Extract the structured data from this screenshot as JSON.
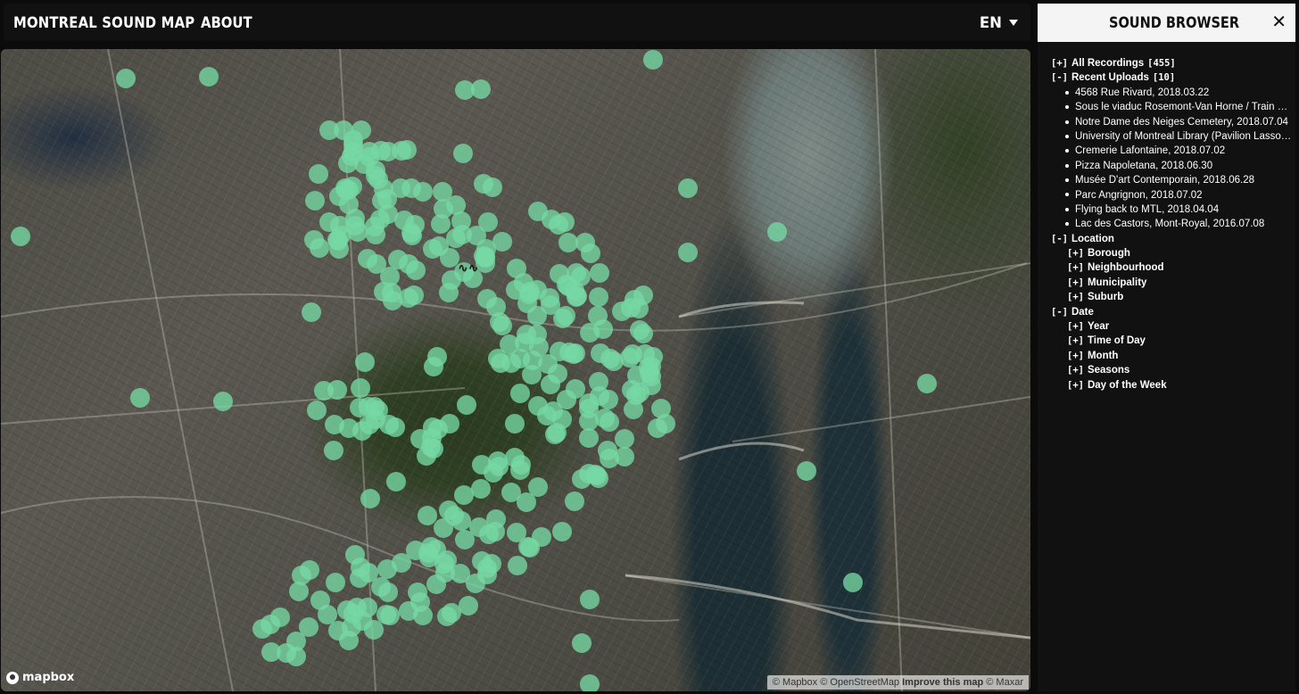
{
  "topbar": {
    "title": "MONTREAL SOUND MAP",
    "about": "ABOUT",
    "language": "EN"
  },
  "map": {
    "marker_color": "#76d8a4",
    "marker_count_visible": 330,
    "wave_glyph": "∿∿",
    "logo": "mapbox",
    "attribution": {
      "mapbox": "© Mapbox",
      "osm": "© OpenStreetMap",
      "improve": "Improve this map",
      "maxar": "© Maxar"
    }
  },
  "sidebar": {
    "title": "SOUND BROWSER",
    "close_icon": "✕",
    "all_recordings": {
      "toggle": "[+]",
      "label": "All Recordings",
      "count": "[455]"
    },
    "recent_uploads": {
      "toggle": "[-]",
      "label": "Recent Uploads",
      "count": "[10]",
      "items": [
        "4568 Rue Rivard, 2018.03.22",
        "Sous le viaduc Rosemont-Van Horne / Train ne...",
        "Notre Dame des Neiges Cemetery, 2018.07.04",
        "University of Montreal Library (Pavilion Lasson...",
        "Cremerie Lafontaine, 2018.07.02",
        "Pizza Napoletana, 2018.06.30",
        "Musée D'art Contemporain, 2018.06.28",
        "Parc Angrignon, 2018.07.02",
        "Flying back to MTL, 2018.04.04",
        "Lac des Castors, Mont-Royal, 2016.07.08"
      ]
    },
    "location": {
      "toggle": "[-]",
      "label": "Location",
      "children": [
        {
          "toggle": "[+]",
          "label": "Borough"
        },
        {
          "toggle": "[+]",
          "label": "Neighbourhood"
        },
        {
          "toggle": "[+]",
          "label": "Municipality"
        },
        {
          "toggle": "[+]",
          "label": "Suburb"
        }
      ]
    },
    "date": {
      "toggle": "[-]",
      "label": "Date",
      "children": [
        {
          "toggle": "[+]",
          "label": "Year"
        },
        {
          "toggle": "[+]",
          "label": "Time of Day"
        },
        {
          "toggle": "[+]",
          "label": "Month"
        },
        {
          "toggle": "[+]",
          "label": "Seasons"
        },
        {
          "toggle": "[+]",
          "label": "Day of the Week"
        }
      ]
    }
  }
}
